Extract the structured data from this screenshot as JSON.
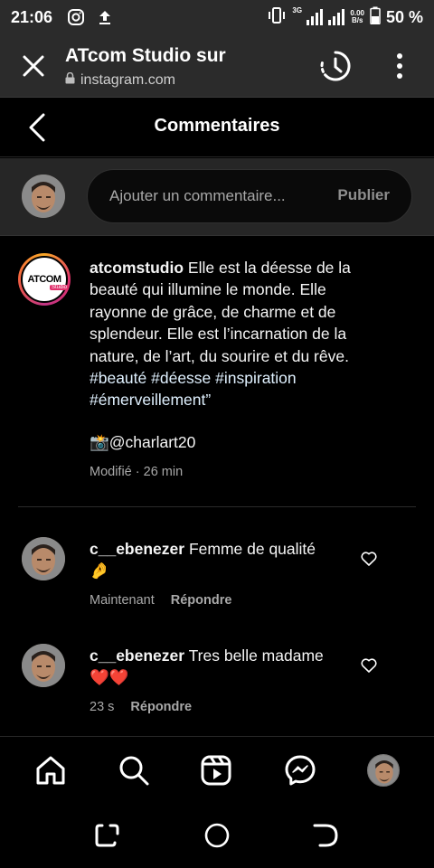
{
  "status_bar": {
    "time": "21:06",
    "network": "3G",
    "speed_value": "0.00",
    "speed_unit": "B/s",
    "battery": "50 %"
  },
  "browser": {
    "title": "ATcom Studio sur",
    "url": "instagram.com"
  },
  "page": {
    "title": "Commentaires"
  },
  "add_comment": {
    "placeholder": "Ajouter un commentaire...",
    "publish_label": "Publier"
  },
  "caption": {
    "username": "atcomstudio",
    "logo_text": "ATCOM",
    "logo_sub": "Studio",
    "text": "Elle est la déesse de la beauté qui illumine le monde. Elle rayonne de grâce, de charme et de splendeur. Elle est l’incarnation de la nature, de l’art, du sourire et du rêve.",
    "hashtags": "#beauté #déesse #inspiration #émerveillement”",
    "mention": "📸@charlart20",
    "meta": "Modifié · 26 min"
  },
  "comments": [
    {
      "username": "c__ebenezer",
      "text": "Femme de qualité",
      "emoji": "🤌",
      "time": "Maintenant",
      "reply_label": "Répondre"
    },
    {
      "username": "c__ebenezer",
      "text": "Tres belle madame",
      "emoji": "❤️❤️",
      "time": "23 s",
      "reply_label": "Répondre"
    }
  ],
  "icons": {
    "close": "close-icon",
    "lock": "lock-icon",
    "history": "history-icon",
    "more": "more-vertical-icon",
    "back": "chevron-left-icon",
    "heart": "heart-outline-icon",
    "home": "home-icon",
    "search": "search-icon",
    "reels": "reels-icon",
    "messenger": "messenger-icon"
  },
  "colors": {
    "background": "#000000",
    "browser_bar": "#2b2b2b",
    "input_bar": "#262626",
    "secondary_text": "#a8a8a8",
    "hashtag": "#e0f1ff"
  }
}
